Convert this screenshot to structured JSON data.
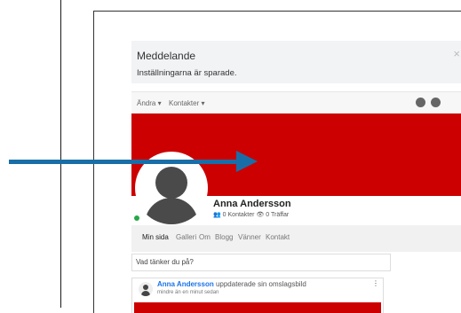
{
  "notice": {
    "title": "Meddelande",
    "text": "Inställningarna är sparade.",
    "close": "×"
  },
  "toolbar": {
    "edit_label": "Ändra ▾",
    "contacts_label": "Kontakter ▾"
  },
  "profile": {
    "name": "Anna Andersson",
    "contacts": "0 Kontakter",
    "views": "0 Träffar"
  },
  "nav": {
    "items": [
      "Min sida",
      "Galleri",
      "Om",
      "Blogg",
      "Vänner",
      "Kontakt"
    ]
  },
  "status": {
    "placeholder": "Vad tänker du på?"
  },
  "post": {
    "author": "Anna Andersson",
    "action": " uppdaterade sin omslagsbild",
    "time": "mindre än en minut sedan",
    "menu": "⋮"
  },
  "colors": {
    "cover": "#cc0000",
    "arrow": "#1a6ea8",
    "online": "#28a745",
    "link": "#1a73e8"
  }
}
